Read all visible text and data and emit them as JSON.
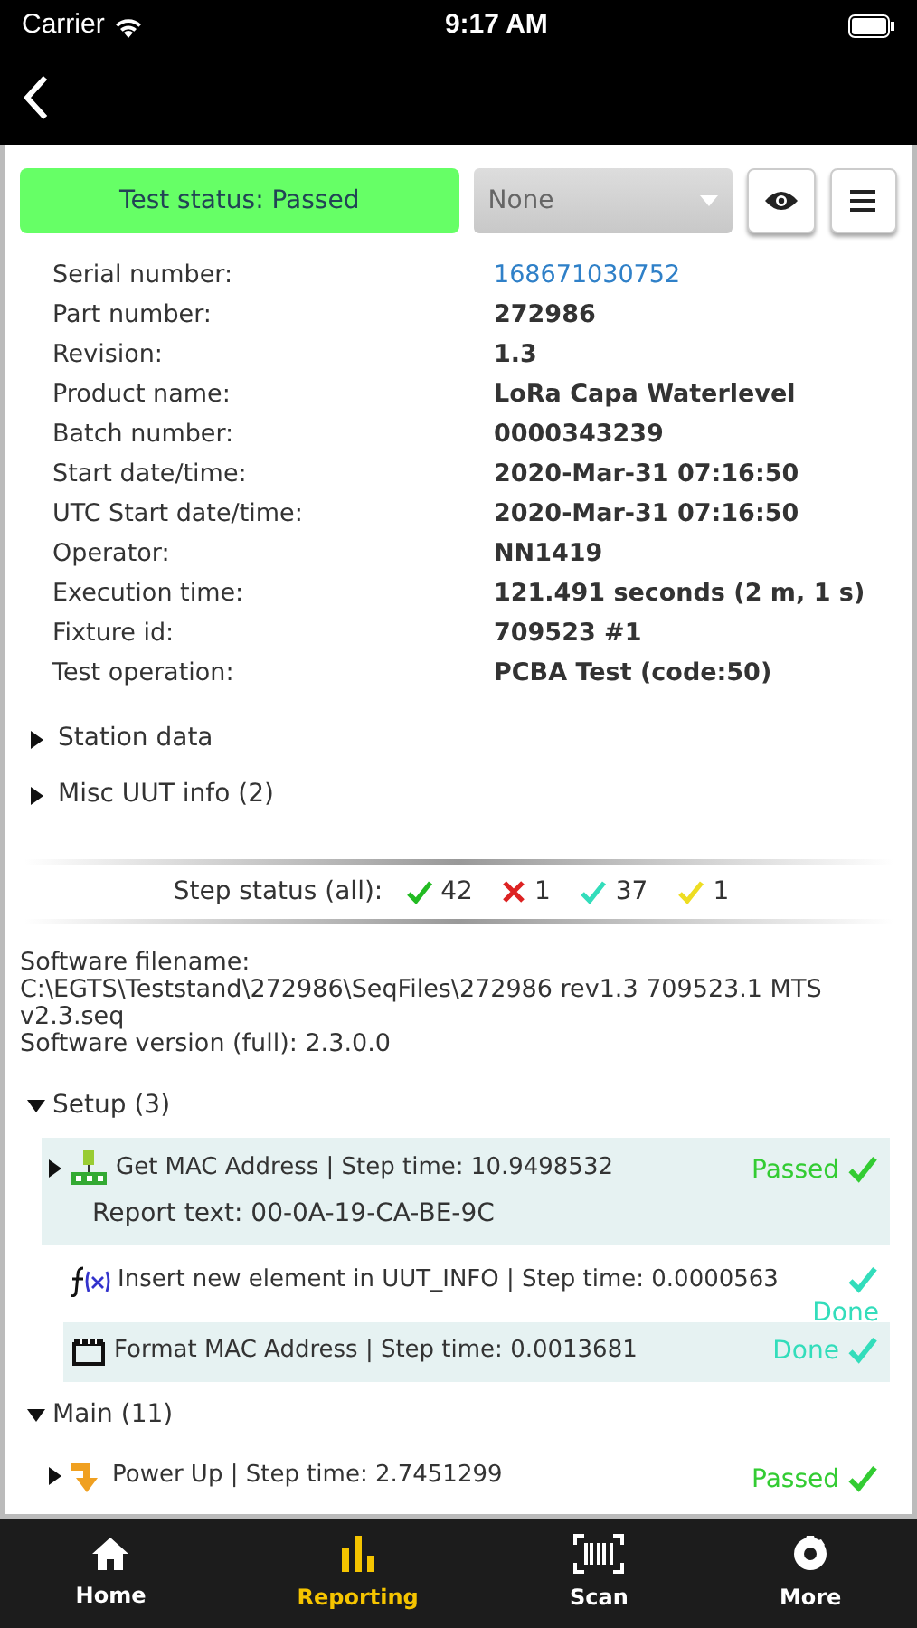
{
  "status_bar": {
    "carrier": "Carrier",
    "time": "9:17 AM"
  },
  "toolbar": {
    "test_status": "Test status: Passed",
    "filter": {
      "value": "None"
    }
  },
  "details": [
    {
      "label": "Serial number:",
      "value": "168671030752",
      "kind": "link"
    },
    {
      "label": "Part number:",
      "value": "272986",
      "kind": "text"
    },
    {
      "label": "Revision:",
      "value": "1.3",
      "kind": "text"
    },
    {
      "label": "Product name:",
      "value": "LoRa Capa Waterlevel",
      "kind": "text"
    },
    {
      "label": "Batch number:",
      "value": "0000343239",
      "kind": "text"
    },
    {
      "label": "Start date/time:",
      "value": "2020-Mar-31 07:16:50",
      "kind": "text"
    },
    {
      "label": "UTC Start date/time:",
      "value": "2020-Mar-31 07:16:50",
      "kind": "text"
    },
    {
      "label": "Operator:",
      "value": "NN1419",
      "kind": "text"
    },
    {
      "label": "Execution time:",
      "value": "121.491 seconds (2 m, 1 s)",
      "kind": "text"
    },
    {
      "label": "Fixture id:",
      "value": "709523 #1",
      "kind": "text"
    },
    {
      "label": "Test operation:",
      "value": "PCBA Test (code:50)",
      "kind": "text"
    }
  ],
  "sections": [
    {
      "label": "Station data",
      "expanded": false
    },
    {
      "label": "Misc UUT info (2)",
      "expanded": false
    }
  ],
  "step_status": {
    "label": "Step status (all):",
    "counts": [
      {
        "kind": "check",
        "count": "42",
        "color": "#22bb22"
      },
      {
        "kind": "cross",
        "count": "1",
        "color": "#dd2222"
      },
      {
        "kind": "check",
        "count": "37",
        "color": "#33ddbb"
      },
      {
        "kind": "check",
        "count": "1",
        "color": "#eedd22"
      }
    ]
  },
  "software": [
    "Software filename:",
    "C:\\EGTS\\Teststand\\272986\\SeqFiles\\272986 rev1.3 709523.1 MTS v2.3.seq",
    "Software version (full): 2.3.0.0"
  ],
  "groups": [
    {
      "label": "Setup (3)",
      "expanded": true,
      "steps": [
        {
          "kind": "network",
          "text": "Get MAC Address | Step time: 10.9498532",
          "report": "Report text: 00-0A-19-CA-BE-9C",
          "status": "Passed",
          "color": "#33cc33",
          "expandable": true,
          "highlighted": true,
          "wrapped": false
        },
        {
          "kind": "function",
          "text": "Insert new element in UUT_INFO | Step time: 0.0000563",
          "status": "Done",
          "color": "#33ddbb",
          "expandable": false,
          "highlighted": false,
          "wrapped": true
        },
        {
          "kind": "clapper",
          "text": "Format MAC Address | Step time: 0.0013681",
          "status": "Done",
          "color": "#33ddbb",
          "expandable": false,
          "highlighted": true,
          "wrapped": false
        }
      ]
    },
    {
      "label": "Main (11)",
      "expanded": true,
      "steps": [
        {
          "kind": "power",
          "text": "Power Up | Step time: 2.7451299",
          "status": "Passed",
          "color": "#33cc33",
          "expandable": true,
          "highlighted": false,
          "wrapped": false
        }
      ]
    }
  ],
  "tabs": [
    {
      "label": "Home",
      "selected": false
    },
    {
      "label": "Reporting",
      "selected": true
    },
    {
      "label": "Scan",
      "selected": false
    },
    {
      "label": "More",
      "selected": false
    }
  ]
}
